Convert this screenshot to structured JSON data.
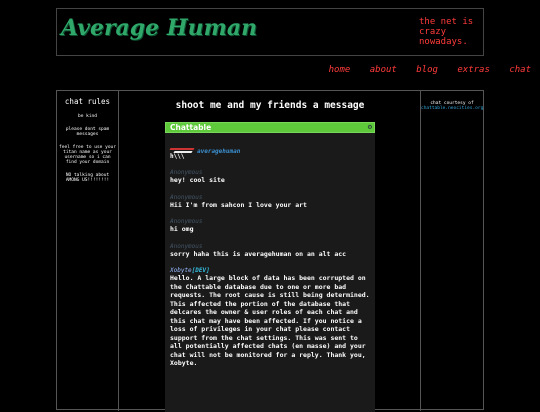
{
  "site": {
    "logo": "Average Human",
    "tagline": "the net is crazy nowadays."
  },
  "nav": {
    "items": [
      "home",
      "about",
      "blog",
      "extras",
      "chat"
    ]
  },
  "sidebar_left": {
    "title": "chat rules",
    "rules": [
      "be kind",
      "please dont spam messages",
      "feel free to use your titan name as your username so i can find your domain",
      "NO talking about AMONG US!!!!!!!!"
    ]
  },
  "sidebar_right": {
    "credit": "chat courtesy of",
    "credit_link": "chattable.neocities.org"
  },
  "main": {
    "title": "shoot me and my friends a message"
  },
  "chat": {
    "brand": "Chattable",
    "settings_icon": "gear-icon",
    "first": {
      "author": "averagehuman",
      "text": "h\\\\\\"
    },
    "messages": [
      {
        "author": "Anonymous",
        "tag": "",
        "text": "hey! cool site"
      },
      {
        "author": "Anonymous",
        "tag": "",
        "text": "Hii I'm from sahcon I love your art"
      },
      {
        "author": "Anonymous",
        "tag": "",
        "text": "hi omg"
      },
      {
        "author": "Anonymous",
        "tag": "",
        "text": "sorry haha this is averagehuman on an alt acc"
      },
      {
        "author": "Xobyte",
        "tag": "[DEV]",
        "text": "Hello. A large block of data has been corrupted on the Chattable database due to one or more bad requests. The root cause is still being determined. This affected the portion of the database that delcares the owner & user roles of each chat and this chat may have been affected. If you notice a loss of privileges in your chat please contact support from the chat settings. This was sent to all potentially affected chats (en masse) and your chat will not be monitored for a reply. Thank you, Xobyte."
      }
    ]
  },
  "colors": {
    "accent": "#ff3b3b",
    "logo": "#2fa86a",
    "chat_bar": "#5ec93a"
  }
}
